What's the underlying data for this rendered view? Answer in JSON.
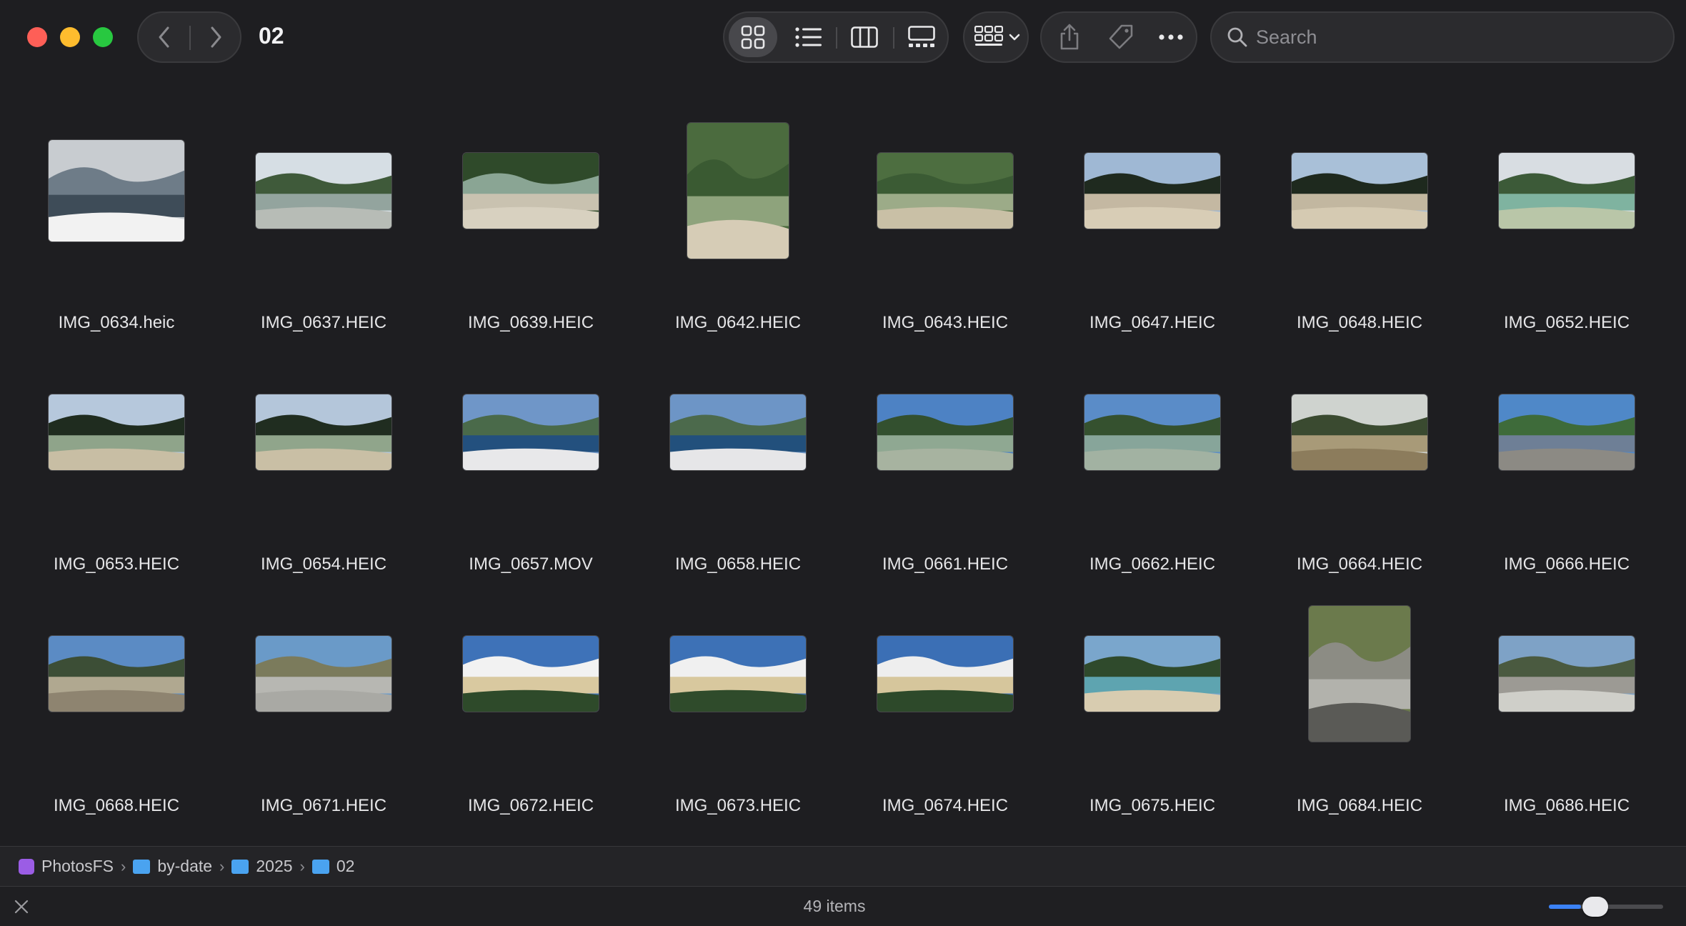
{
  "window": {
    "title": "02"
  },
  "toolbar": {
    "back_icon": "chevron-left-icon",
    "forward_icon": "chevron-right-icon",
    "views": [
      {
        "name": "icon-view",
        "icon": "grid-icon",
        "active": true
      },
      {
        "name": "list-view",
        "icon": "list-icon",
        "active": false
      },
      {
        "name": "column-view",
        "icon": "columns-icon",
        "active": false
      },
      {
        "name": "gallery-view",
        "icon": "gallery-icon",
        "active": false
      }
    ],
    "group_icon": "group-grid-icon",
    "share_icon": "share-icon",
    "tag_icon": "tag-icon",
    "more_icon": "ellipsis-icon"
  },
  "search": {
    "placeholder": "Search",
    "value": ""
  },
  "files": [
    {
      "name": "IMG_0634.heic",
      "orientation": "land",
      "palette": [
        "#c8ccd0",
        "#6e7c88",
        "#3e4c58",
        "#f2f2f2"
      ]
    },
    {
      "name": "IMG_0637.HEIC",
      "orientation": "wide",
      "palette": [
        "#d6dee4",
        "#3f5a3a",
        "#93a49e",
        "#b7bcb6"
      ]
    },
    {
      "name": "IMG_0639.HEIC",
      "orientation": "wide",
      "palette": [
        "#2f4a2a",
        "#8aa594",
        "#c9c2b0",
        "#d8d1c0"
      ]
    },
    {
      "name": "IMG_0642.HEIC",
      "orientation": "port",
      "palette": [
        "#4b6b3e",
        "#3a5a32",
        "#8ea37c",
        "#d6ccb6"
      ]
    },
    {
      "name": "IMG_0643.HEIC",
      "orientation": "wide",
      "palette": [
        "#4d6e40",
        "#3b5b34",
        "#9cab88",
        "#c9c0a6"
      ]
    },
    {
      "name": "IMG_0647.HEIC",
      "orientation": "wide",
      "palette": [
        "#9fb8d4",
        "#1f2a1f",
        "#c4b8a2",
        "#d8cdb6"
      ]
    },
    {
      "name": "IMG_0648.HEIC",
      "orientation": "wide",
      "palette": [
        "#a9c0d8",
        "#1e291e",
        "#c2b7a0",
        "#d5cab2"
      ]
    },
    {
      "name": "IMG_0652.HEIC",
      "orientation": "wide",
      "palette": [
        "#d8dde2",
        "#3c5a38",
        "#7fb3a0",
        "#b9c6a8"
      ]
    },
    {
      "name": "IMG_0653.HEIC",
      "orientation": "wide",
      "palette": [
        "#b6c8dc",
        "#1f2c1f",
        "#8fa48a",
        "#c8bea4"
      ]
    },
    {
      "name": "IMG_0654.HEIC",
      "orientation": "wide",
      "palette": [
        "#b4c6da",
        "#202d20",
        "#90a58b",
        "#c9bfa5"
      ]
    },
    {
      "name": "IMG_0657.MOV",
      "orientation": "wide",
      "palette": [
        "#6f96c8",
        "#4a6a4a",
        "#23507e",
        "#e8e8ea"
      ]
    },
    {
      "name": "IMG_0658.HEIC",
      "orientation": "wide",
      "palette": [
        "#6d95c6",
        "#4c6a4c",
        "#22507c",
        "#e6e6e8"
      ]
    },
    {
      "name": "IMG_0661.HEIC",
      "orientation": "wide",
      "palette": [
        "#4d82c4",
        "#33502f",
        "#8fa892",
        "#a7b3a0"
      ]
    },
    {
      "name": "IMG_0662.HEIC",
      "orientation": "wide",
      "palette": [
        "#5a8cc8",
        "#35512f",
        "#87a59a",
        "#a2b2a2"
      ]
    },
    {
      "name": "IMG_0664.HEIC",
      "orientation": "wide",
      "palette": [
        "#cfd3cf",
        "#3a4a30",
        "#a89a78",
        "#8c7c5c"
      ]
    },
    {
      "name": "IMG_0666.HEIC",
      "orientation": "wide",
      "palette": [
        "#4f88c8",
        "#3e6b3a",
        "#6e7f96",
        "#8c8a84"
      ]
    },
    {
      "name": "IMG_0668.HEIC",
      "orientation": "wide",
      "palette": [
        "#5b8bc4",
        "#3c4e36",
        "#b0a890",
        "#8e8470"
      ]
    },
    {
      "name": "IMG_0671.HEIC",
      "orientation": "wide",
      "palette": [
        "#6a9ac8",
        "#7b7b5c",
        "#b7b7b2",
        "#a9a9a4"
      ]
    },
    {
      "name": "IMG_0672.HEIC",
      "orientation": "wide",
      "palette": [
        "#3e72b8",
        "#f2f2f2",
        "#d9c9a0",
        "#2e4a2a"
      ]
    },
    {
      "name": "IMG_0673.HEIC",
      "orientation": "wide",
      "palette": [
        "#3d71b6",
        "#f0f0f0",
        "#d8c89e",
        "#2f4b2b"
      ]
    },
    {
      "name": "IMG_0674.HEIC",
      "orientation": "wide",
      "palette": [
        "#3b6fb5",
        "#eeeeee",
        "#d6c69c",
        "#2d492a"
      ]
    },
    {
      "name": "IMG_0675.HEIC",
      "orientation": "wide",
      "palette": [
        "#7aa6cc",
        "#2f4a2c",
        "#5ea4b0",
        "#d8ccb0"
      ]
    },
    {
      "name": "IMG_0684.HEIC",
      "orientation": "port",
      "palette": [
        "#6b7a4c",
        "#8c8c84",
        "#b2b2ac",
        "#5a5a56"
      ]
    },
    {
      "name": "IMG_0686.HEIC",
      "orientation": "wide",
      "palette": [
        "#7ea2c6",
        "#4a5a40",
        "#9c9a94",
        "#cfcfc9"
      ]
    }
  ],
  "pathbar": [
    {
      "label": "PhotosFS",
      "icon": "photosfs-icon"
    },
    {
      "label": "by-date",
      "icon": "folder-icon"
    },
    {
      "label": "2025",
      "icon": "folder-icon"
    },
    {
      "label": "02",
      "icon": "folder-icon"
    }
  ],
  "status": {
    "item_count": "49 items",
    "icon_size_fraction": 0.28
  }
}
